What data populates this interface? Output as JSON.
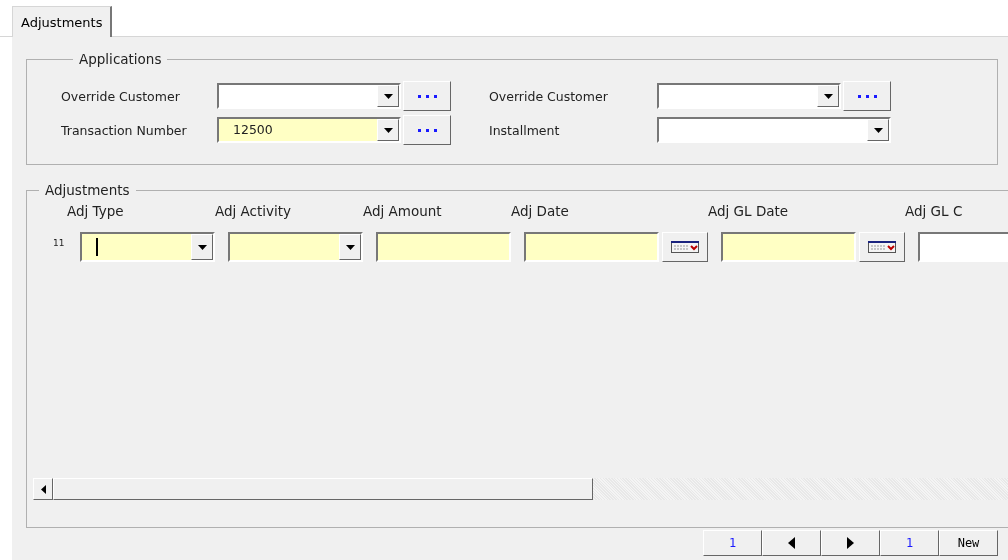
{
  "tabs": [
    {
      "label": "Adjustments",
      "selected": true
    }
  ],
  "applications": {
    "title": "Applications",
    "fields": [
      {
        "label": "Override Customer",
        "kind": "combo_lookup",
        "required": false
      },
      {
        "label": "Override Customer",
        "kind": "combo_lookup",
        "required": false
      },
      {
        "label": "Transaction Number",
        "kind": "combo_lookup",
        "value": "12500",
        "required": true
      },
      {
        "label": "Installment",
        "kind": "combo",
        "required": false
      }
    ]
  },
  "adjustments": {
    "title": "Adjustments",
    "row_number": "11",
    "columns": [
      {
        "label": "Adj Type",
        "kind": "combo",
        "required": true,
        "focused": true
      },
      {
        "label": "Adj Activity",
        "kind": "combo",
        "required": true,
        "focused": false
      },
      {
        "label": "Adj Amount",
        "kind": "text",
        "required": true,
        "focused": false
      },
      {
        "label": "Adj Date",
        "kind": "date",
        "required": true,
        "focused": false
      },
      {
        "label": "Adj GL Date",
        "kind": "date",
        "required": true,
        "focused": false
      },
      {
        "label": "Adj GL C",
        "kind": "text",
        "required": false,
        "focused": false
      }
    ]
  },
  "navigator": {
    "first": "1",
    "last": "1",
    "new": "New"
  }
}
